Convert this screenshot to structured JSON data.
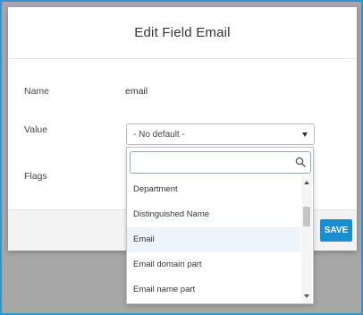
{
  "background": {
    "partial_text": ""
  },
  "modal": {
    "title": "Edit Field Email",
    "fields": {
      "name": {
        "label": "Name",
        "value": "email"
      },
      "value": {
        "label": "Value",
        "selected": "- No default -"
      },
      "flags": {
        "label": "Flags"
      }
    },
    "save_label": "SAVE"
  },
  "dropdown": {
    "search_value": "",
    "options": [
      "Department",
      "Distinguished Name",
      "Email",
      "Email domain part",
      "Email name part"
    ],
    "highlighted": "Email"
  },
  "colors": {
    "accent": "#1a8fd0",
    "frame": "#2f95d3",
    "highlight": "#eef5fa"
  }
}
